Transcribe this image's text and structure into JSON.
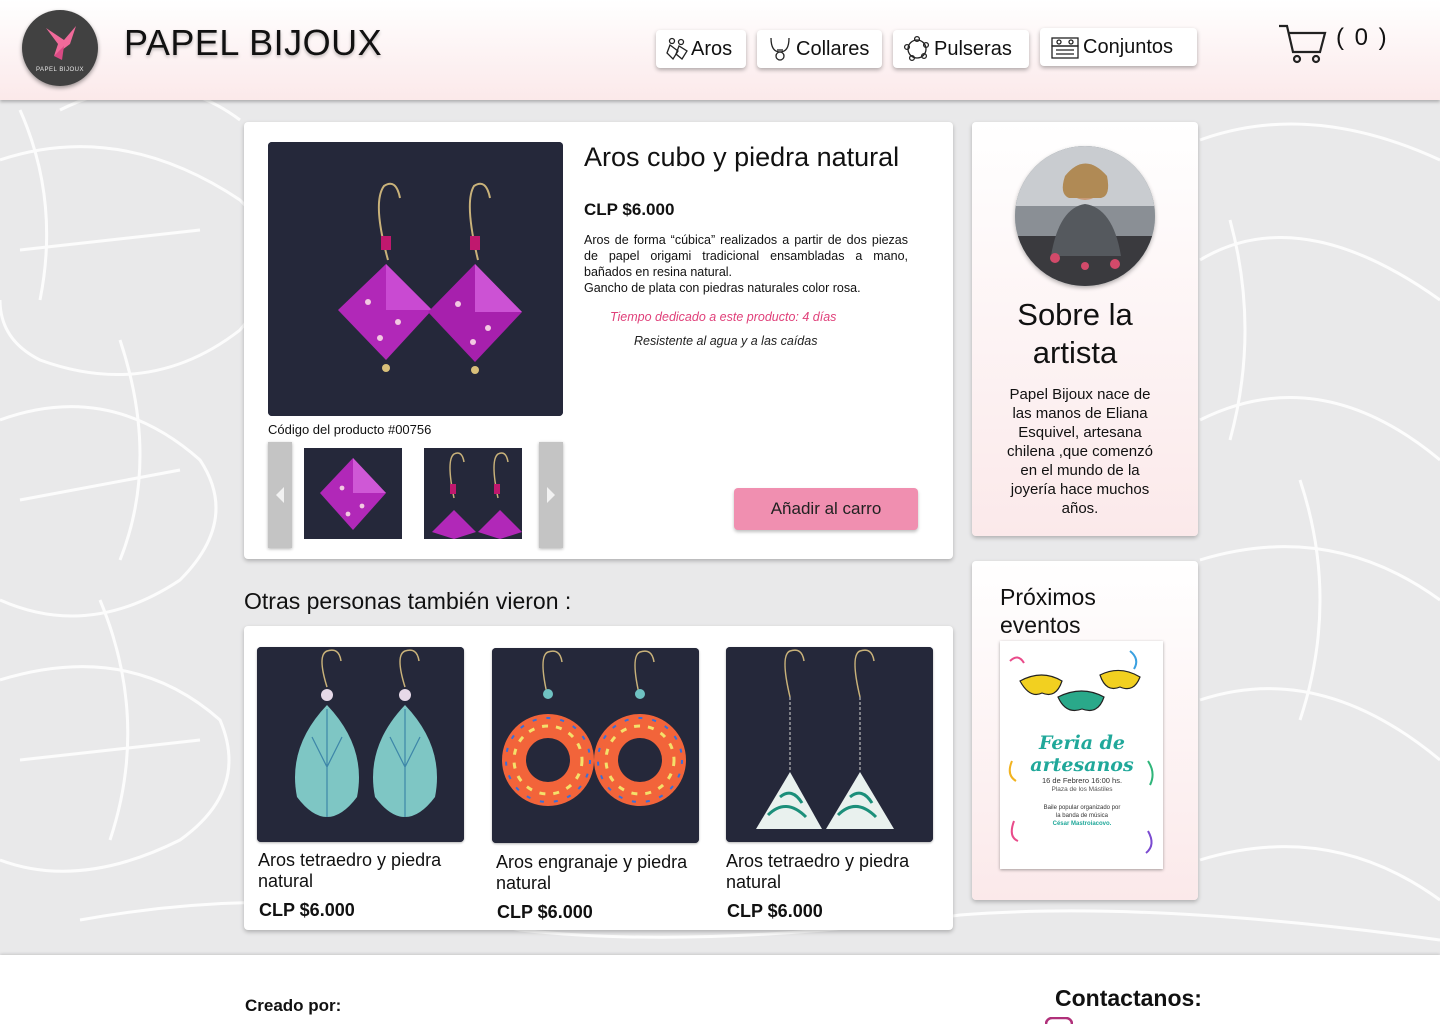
{
  "header": {
    "brand": "PAPEL BIJOUX",
    "logo_text": "PAPEL BIJOUX",
    "nav": [
      {
        "label": "Aros",
        "icon": "earrings-icon"
      },
      {
        "label": "Collares",
        "icon": "necklace-icon"
      },
      {
        "label": "Pulseras",
        "icon": "bracelet-icon"
      },
      {
        "label": "Conjuntos",
        "icon": "jewelry-box-icon"
      }
    ],
    "cart_count": "( 0 )"
  },
  "product": {
    "title": "Aros cubo y piedra natural",
    "price": "CLP $6.000",
    "description_1": "Aros de forma “cúbica” realizados a partir de dos piezas de papel origami tradicional ensambladas a mano, bañados en resina natural.",
    "description_2": "Gancho de plata con piedras naturales color rosa.",
    "time_note": "Tiempo dedicado a este producto: 4 días",
    "resistance_note": "Resistente al agua y a las caídas",
    "code": "Código del producto #00756",
    "add_button": "Añadir al carro"
  },
  "artist": {
    "title": "Sobre la artista",
    "text": "Papel Bijoux nace de las manos de Eliana Esquivel, artesana chilena ,que comenzó en el mundo de la joyería hace muchos años."
  },
  "events": {
    "title": "Próximos eventos",
    "poster_title_1": "Feria de",
    "poster_title_2": "artesanos",
    "poster_date": "16 de Febrero 16:00 hs.",
    "poster_place": "Plaza de los Mástiles",
    "poster_line_1": "Baile popular organizado por",
    "poster_line_2": "la banda de música",
    "poster_line_3": "César Mastroiacovo."
  },
  "others": {
    "title": "Otras personas también vieron :",
    "items": [
      {
        "name": "Aros tetraedro y piedra natural",
        "price": "CLP $6.000"
      },
      {
        "name": "Aros engranaje y piedra natural",
        "price": "CLP $6.000"
      },
      {
        "name": "Aros tetraedro y piedra natural",
        "price": "CLP $6.000"
      }
    ]
  },
  "footer": {
    "created_by": "Creado por:",
    "contact": "Contactanos:"
  },
  "colors": {
    "accent_pink": "#f08fb0",
    "time_note": "#e0407a",
    "header_gradient_end": "#fbe9ea"
  }
}
